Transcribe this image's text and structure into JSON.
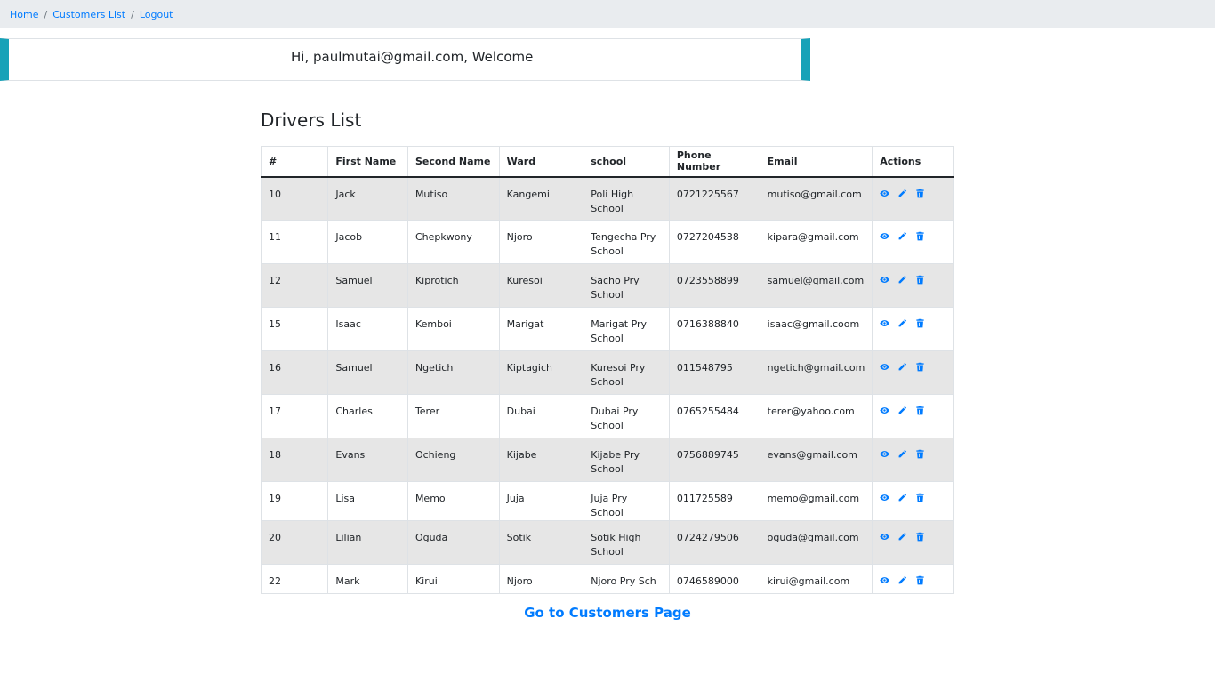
{
  "breadcrumb": {
    "items": [
      "Home",
      "Customers List",
      "Logout"
    ],
    "separator": "/"
  },
  "welcome": {
    "message": "Hi, paulmutai@gmail.com, Welcome"
  },
  "page": {
    "title": "Drivers List"
  },
  "table": {
    "headers": [
      "#",
      "First Name",
      "Second Name",
      "Ward",
      "school",
      "Phone Number",
      "Email",
      "Actions"
    ],
    "rows": [
      {
        "id": "10",
        "first_name": "Jack",
        "second_name": "Mutiso",
        "ward": "Kangemi",
        "school": "Poli High School",
        "phone": "0721225567",
        "email": "mutiso@gmail.com"
      },
      {
        "id": "11",
        "first_name": "Jacob",
        "second_name": "Chepkwony",
        "ward": "Njoro",
        "school": "Tengecha Pry School",
        "phone": "0727204538",
        "email": "kipara@gmail.com"
      },
      {
        "id": "12",
        "first_name": "Samuel",
        "second_name": "Kiprotich",
        "ward": "Kuresoi",
        "school": "Sacho Pry School",
        "phone": "0723558899",
        "email": "samuel@gmail.com"
      },
      {
        "id": "15",
        "first_name": "Isaac",
        "second_name": "Kemboi",
        "ward": "Marigat",
        "school": "Marigat Pry School",
        "phone": "0716388840",
        "email": "isaac@gmail.coom"
      },
      {
        "id": "16",
        "first_name": "Samuel",
        "second_name": "Ngetich",
        "ward": "Kiptagich",
        "school": "Kuresoi Pry School",
        "phone": "011548795",
        "email": "ngetich@gmail.com"
      },
      {
        "id": "17",
        "first_name": "Charles",
        "second_name": "Terer",
        "ward": "Dubai",
        "school": "Dubai Pry School",
        "phone": "0765255484",
        "email": "terer@yahoo.com"
      },
      {
        "id": "18",
        "first_name": "Evans",
        "second_name": "Ochieng",
        "ward": "Kijabe",
        "school": "Kijabe Pry School",
        "phone": "0756889745",
        "email": "evans@gmail.com"
      },
      {
        "id": "19",
        "first_name": "Lisa",
        "second_name": "Memo",
        "ward": "Juja",
        "school": "Juja Pry School",
        "phone": "011725589",
        "email": "memo@gmail.com"
      },
      {
        "id": "20",
        "first_name": "Lilian",
        "second_name": "Oguda",
        "ward": "Sotik",
        "school": "Sotik High School",
        "phone": "0724279506",
        "email": "oguda@gmail.com"
      },
      {
        "id": "22",
        "first_name": "Mark",
        "second_name": "Kirui",
        "ward": "Njoro",
        "school": "Njoro Pry Sch",
        "phone": "0746589000",
        "email": "kirui@gmail.com"
      }
    ],
    "action_icons": [
      "eye-icon",
      "pencil-icon",
      "trash-icon"
    ]
  },
  "footer": {
    "link_label": "Go to Customers Page"
  },
  "colors": {
    "accent": "#007bff",
    "welcome_border": "#17a2b8",
    "breadcrumb_bg": "#e9ecef",
    "stripe": "#e6e6e6"
  }
}
